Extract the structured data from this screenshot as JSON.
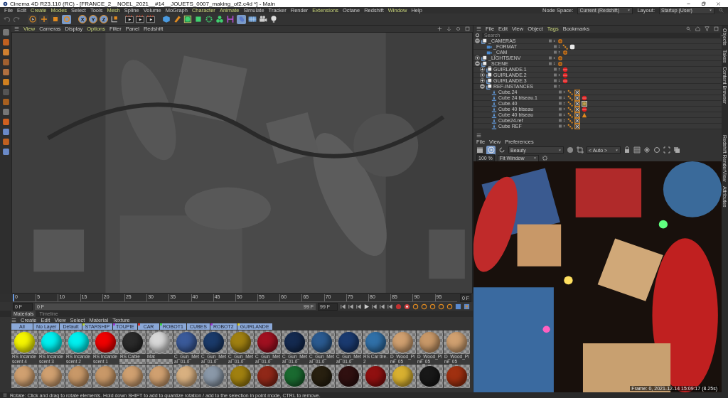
{
  "window": {
    "title": "Cinema 4D R23.110 (RC) - [FRANCE_2__NOEL_2021__#14__JOUETS_0007_making_of2.c4d *] - Main"
  },
  "menu": [
    {
      "label": "File",
      "accent": false
    },
    {
      "label": "Edit",
      "accent": false
    },
    {
      "label": "Create",
      "accent": true
    },
    {
      "label": "Modes",
      "accent": true
    },
    {
      "label": "Select",
      "accent": false
    },
    {
      "label": "Tools",
      "accent": false
    },
    {
      "label": "Mesh",
      "accent": true
    },
    {
      "label": "Spline",
      "accent": false
    },
    {
      "label": "Volume",
      "accent": false
    },
    {
      "label": "MoGraph",
      "accent": false
    },
    {
      "label": "Character",
      "accent": true
    },
    {
      "label": "Animate",
      "accent": true
    },
    {
      "label": "Simulate",
      "accent": false
    },
    {
      "label": "Tracker",
      "accent": false
    },
    {
      "label": "Render",
      "accent": false
    },
    {
      "label": "Extensions",
      "accent": true
    },
    {
      "label": "Octane",
      "accent": false
    },
    {
      "label": "Redshift",
      "accent": false
    },
    {
      "label": "Window",
      "accent": true
    },
    {
      "label": "Help",
      "accent": false
    }
  ],
  "node_space": {
    "label": "Node Space:",
    "value": "Current (Redshift)"
  },
  "layout": {
    "label": "Layout:",
    "value": "Startup (User)"
  },
  "toolbar": {
    "tools": [
      {
        "kind": "select",
        "selected": false
      },
      {
        "kind": "move",
        "selected": false
      },
      {
        "kind": "scale",
        "selected": false
      },
      {
        "kind": "rotate",
        "selected": true
      }
    ],
    "axes": [
      {
        "label": "X",
        "selected": true
      },
      {
        "label": "Y",
        "selected": true
      },
      {
        "label": "Z",
        "selected": true
      }
    ]
  },
  "viewport": {
    "menu": [
      {
        "label": "View",
        "accent": true
      },
      {
        "label": "Cameras",
        "accent": false
      },
      {
        "label": "Display",
        "accent": false
      },
      {
        "label": "Options",
        "accent": true
      },
      {
        "label": "Filter",
        "accent": false
      },
      {
        "label": "Panel",
        "accent": false
      },
      {
        "label": "Redshift",
        "accent": false
      }
    ]
  },
  "timeline": {
    "ticks": [
      "0",
      "5",
      "10",
      "15",
      "20",
      "25",
      "30",
      "35",
      "40",
      "45",
      "50",
      "55",
      "60",
      "65",
      "70",
      "75",
      "80",
      "85",
      "90",
      "95"
    ],
    "current": "0 F",
    "start": "0 F",
    "range": {
      "start": "0 F",
      "end": "99 F",
      "level": 1
    },
    "end": "99 F"
  },
  "materials": {
    "tabs": [
      {
        "label": "Materials",
        "selected": true
      },
      {
        "label": "Timeline",
        "selected": false
      }
    ],
    "menu": [
      "Create",
      "Edit",
      "View",
      "Select",
      "Material",
      "Texture"
    ],
    "layers": [
      {
        "label": "All"
      },
      {
        "label": "No Layer"
      },
      {
        "label": "Default"
      },
      {
        "label": "STARSHIP",
        "color": "#b8d43a"
      },
      {
        "label": "TOUPIE",
        "color": "#9a3ad4"
      },
      {
        "label": "CAR",
        "color": "#d42a2a"
      },
      {
        "label": "ROBOT1",
        "color": "#3ad44a"
      },
      {
        "label": "CUBES"
      },
      {
        "label": "ROBOT2",
        "color": "#9a3ad4"
      },
      {
        "label": "GUIRLANDE",
        "color": "#e0d030"
      }
    ],
    "items": [
      {
        "label": "RS Incandescent 4",
        "color": "#f5f500"
      },
      {
        "label": "RS Incandescent 3",
        "color": "#00f0f0"
      },
      {
        "label": "RS Incandescent 2",
        "color": "#00f0f0"
      },
      {
        "label": "RS Incandescent 1",
        "color": "#f00000"
      },
      {
        "label": "RS Cable",
        "color": "#2a2a2a"
      },
      {
        "label": "Mat",
        "color": "#d8d8d8"
      },
      {
        "label": "C_Gun_Metal_01.0",
        "color": "#3a5a9a"
      },
      {
        "label": "C_Gun_Metal_01.0",
        "color": "#1a3a6a"
      },
      {
        "label": "C_Gun_Metal_01.0",
        "color": "#a08010"
      },
      {
        "label": "C_Gun_Metal_01.0",
        "color": "#a01020"
      },
      {
        "label": "C_Gun_Metal_01.0",
        "color": "#142a50"
      },
      {
        "label": "C_Gun_Metal_01.0",
        "color": "#2a5a90"
      },
      {
        "label": "C_Gun_Metal_01.0",
        "color": "#1a3a70"
      },
      {
        "label": "RS Car tire.2",
        "color": "#3070a8"
      },
      {
        "label": "D_Wood_Pine_05",
        "color": "#d0a070"
      },
      {
        "label": "D_Wood_Pine_05",
        "color": "#c89868"
      },
      {
        "label": "D_Wood_Pine_05",
        "color": "#d0a070"
      },
      {
        "color": "#d0a070"
      },
      {
        "color": "#d0a070"
      },
      {
        "color": "#c89868"
      },
      {
        "color": "#c89868"
      },
      {
        "color": "#d0a070"
      },
      {
        "color": "#d0a070"
      },
      {
        "color": "#d8b080"
      },
      {
        "color": "#8a98a8"
      },
      {
        "color": "#a08010"
      },
      {
        "color": "#902818"
      },
      {
        "color": "#1a6a30"
      },
      {
        "color": "#282010"
      },
      {
        "color": "#301010"
      },
      {
        "color": "#901010"
      },
      {
        "color": "#d8b030"
      },
      {
        "color": "#181818"
      },
      {
        "color": "#a03010"
      }
    ]
  },
  "status_bar": "Rotate: Click and drag to rotate elements. Hold down SHIFT to add to quantize rotation / add to the selection in point mode, CTRL to remove.",
  "objects": {
    "menu": [
      {
        "label": "File",
        "accent": false
      },
      {
        "label": "Edit",
        "accent": false
      },
      {
        "label": "View",
        "accent": false
      },
      {
        "label": "Object",
        "accent": false
      },
      {
        "label": "Tags",
        "accent": true
      },
      {
        "label": "Bookmarks",
        "accent": false
      }
    ],
    "search": {
      "placeholder": "Search"
    },
    "tree": [
      {
        "name": "_CAMERAS",
        "kind": "null",
        "expanded": true,
        "tags": [
          {
            "kind": "ball"
          }
        ],
        "children": [
          {
            "name": "_FORMAT",
            "kind": "camera",
            "tags": [
              {
                "kind": "dots"
              },
              {
                "kind": "glow"
              }
            ]
          },
          {
            "name": "_CAM",
            "kind": "camera",
            "tags": [
              {
                "kind": "ball"
              }
            ]
          }
        ]
      },
      {
        "name": "_LIGHTS/ENV",
        "kind": "null",
        "expanded": false,
        "tags": [
          {
            "kind": "ball"
          }
        ]
      },
      {
        "name": "_SCENE",
        "kind": "null",
        "expanded": true,
        "tags": [
          {
            "kind": "ball"
          }
        ],
        "children": [
          {
            "name": "GUIRLANDE.1",
            "kind": "null",
            "expanded": false,
            "tags": [
              {
                "kind": "sphere"
              }
            ]
          },
          {
            "name": "GUIRLANDE.2",
            "kind": "null",
            "expanded": false,
            "tags": [
              {
                "kind": "sphere"
              }
            ]
          },
          {
            "name": "GUIRLANDE.3",
            "kind": "null",
            "expanded": false,
            "tags": [
              {
                "kind": "sphere"
              }
            ]
          },
          {
            "name": "REF-INSTANCES",
            "kind": "null",
            "expanded": true,
            "children": [
              {
                "name": "Cube.24",
                "kind": "instance",
                "tags": [
                  {
                    "kind": "dots"
                  },
                  {
                    "kind": "grid"
                  }
                ]
              },
              {
                "name": "Cube 24 biseau.1",
                "kind": "instance",
                "tags": [
                  {
                    "kind": "dots"
                  },
                  {
                    "kind": "grid"
                  },
                  {
                    "kind": "sphere"
                  }
                ]
              },
              {
                "name": "Cube.40",
                "kind": "instance",
                "tags": [
                  {
                    "kind": "dots"
                  },
                  {
                    "kind": "grid"
                  },
                  {
                    "kind": "texture"
                  }
                ]
              },
              {
                "name": "Cube 40 biseau",
                "kind": "instance",
                "tags": [
                  {
                    "kind": "dots"
                  },
                  {
                    "kind": "grid"
                  },
                  {
                    "kind": "sphere"
                  }
                ]
              },
              {
                "name": "Cube 40 biseau",
                "kind": "instance",
                "tags": [
                  {
                    "kind": "dots"
                  },
                  {
                    "kind": "grid"
                  },
                  {
                    "kind": "cone"
                  }
                ]
              },
              {
                "name": "Cube24.ref",
                "kind": "instance",
                "tags": [
                  {
                    "kind": "dots"
                  },
                  {
                    "kind": "grid"
                  }
                ]
              },
              {
                "name": "Cube REF",
                "kind": "instance",
                "tags": [
                  {
                    "kind": "dots"
                  },
                  {
                    "kind": "grid"
                  }
                ]
              }
            ]
          }
        ]
      }
    ]
  },
  "side_tabs_top": [
    "Objects",
    "Takes",
    "Content Browser"
  ],
  "side_tabs_bottom": [
    "Redshift RenderView",
    "Attributes"
  ],
  "render_view": {
    "menu": [
      "File",
      "View",
      "Preferences"
    ],
    "aov": "Beauty",
    "camera": "< Auto >",
    "zoom": "100 %",
    "fit": "Fit Window",
    "caption": "Frame: 0, 2021-12-14 15:09:17 (8.25s)"
  }
}
